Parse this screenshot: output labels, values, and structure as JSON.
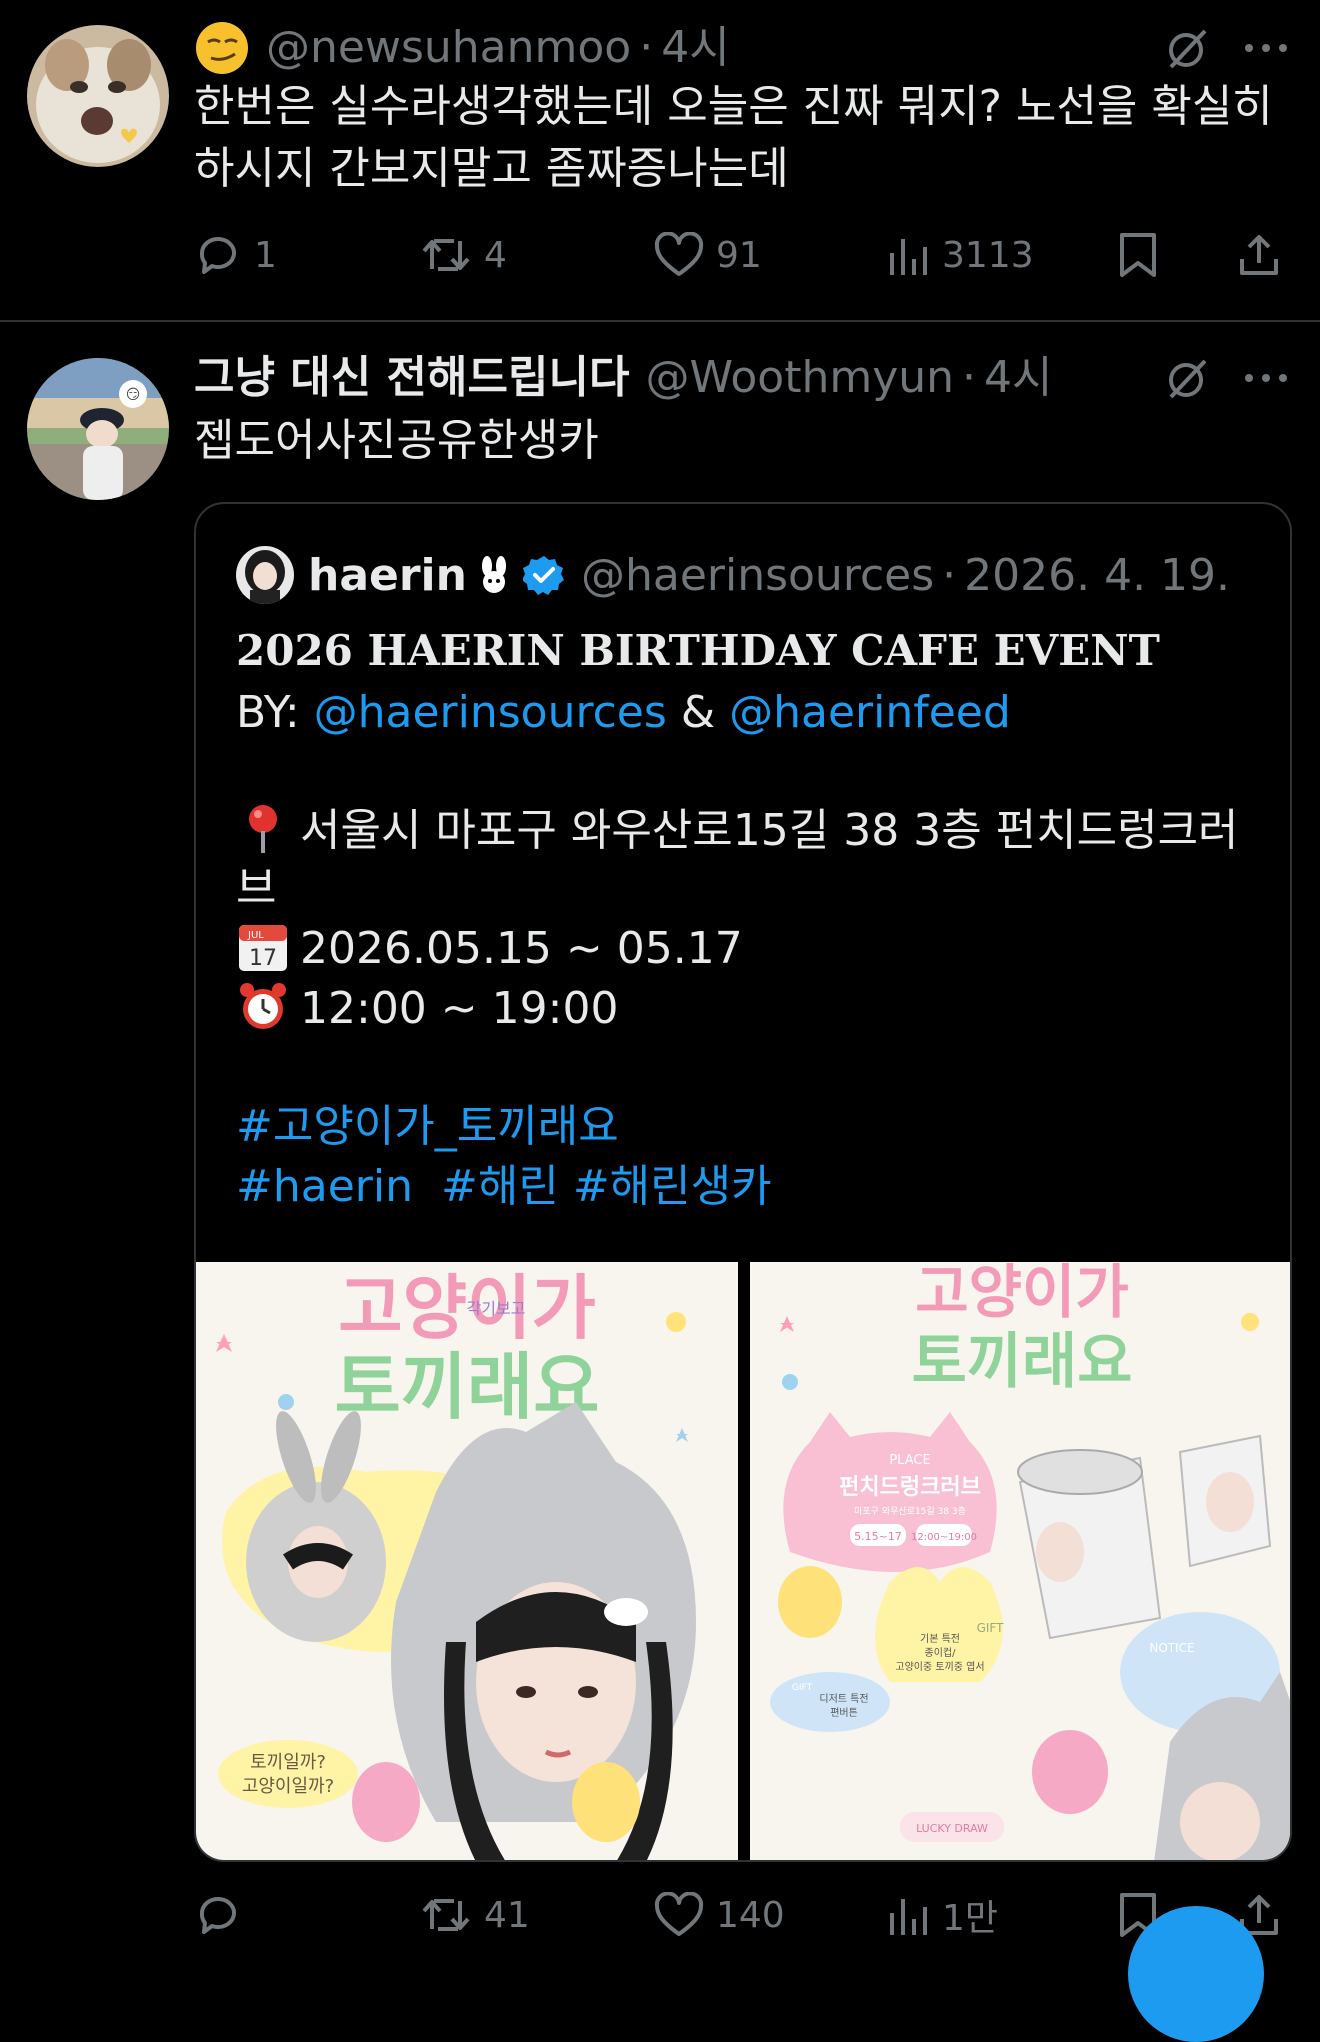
{
  "post1": {
    "emoji": "smirk-emoji",
    "handle": "@newsuhanmoo",
    "sep": "·",
    "time": "4시",
    "text_line1": "한번은 실수라생각했는데 오늘은 진짜 뭐지? 노선을 확실히",
    "text_line2": "하시지 간보지말고 좀짜증나는데",
    "replies": "1",
    "reposts": "4",
    "likes": "91",
    "views": "3113"
  },
  "post2": {
    "name": "그냥 대신 전해드립니다",
    "handle": "@Woothmyun",
    "sep": "·",
    "time": "4시",
    "text": "젭도어사진공유한생카",
    "replies": "",
    "reposts": "41",
    "likes": "140",
    "views": "1만",
    "quote": {
      "name": "haerin",
      "name_emoji": "🐰",
      "handle": "@haerinsources",
      "sep": "·",
      "date": "2026. 4. 19.",
      "title": "2026 HAERIN BIRTHDAY CAFE EVENT",
      "by_label": "BY:",
      "by_link1": "@haerinsources",
      "by_amp": "&",
      "by_link2": "@haerinfeed",
      "location_line1": "서울시 마포구 와우산로15길 38 3층 펀치드렁크러",
      "location_line2": "브",
      "date_range": "2026.05.15 ~ 05.17",
      "time_range": "12:00 ~ 19:00",
      "hashtag1": "#고양이가_토끼래요",
      "hashtag2": "#haerin",
      "hashtag3": "#해린",
      "hashtag4": "#해린생카",
      "images": {
        "left_title": "고양이가 토끼래요",
        "left_sub": "각기보고",
        "left_bubble_1": "토끼일까?",
        "left_bubble_2": "고양이일까?",
        "right_title": "고양이가 토끼래요",
        "right_place_label": "PLACE",
        "right_place": "펀치드렁크러브",
        "right_place_addr": "마포구 와우산로15길 38 3층",
        "right_date": "5.15~17",
        "right_time": "12:00~19:00",
        "right_notice": "NOTICE",
        "right_gift": "GIFT",
        "right_gift_desc1": "기본 특전",
        "right_gift_desc2": "종이컵/",
        "right_gift_desc3": "고양이중 토끼중 엽서",
        "right_gift2": "GIFT",
        "right_gift2_desc1": "디저트 특전",
        "right_gift2_desc2": "편버튼",
        "right_lucky": "LUCKY DRAW"
      }
    }
  },
  "colors": {
    "link": "#1d9bf0",
    "muted": "#71767b",
    "background": "#000000",
    "verified": "#1d9bf0"
  }
}
